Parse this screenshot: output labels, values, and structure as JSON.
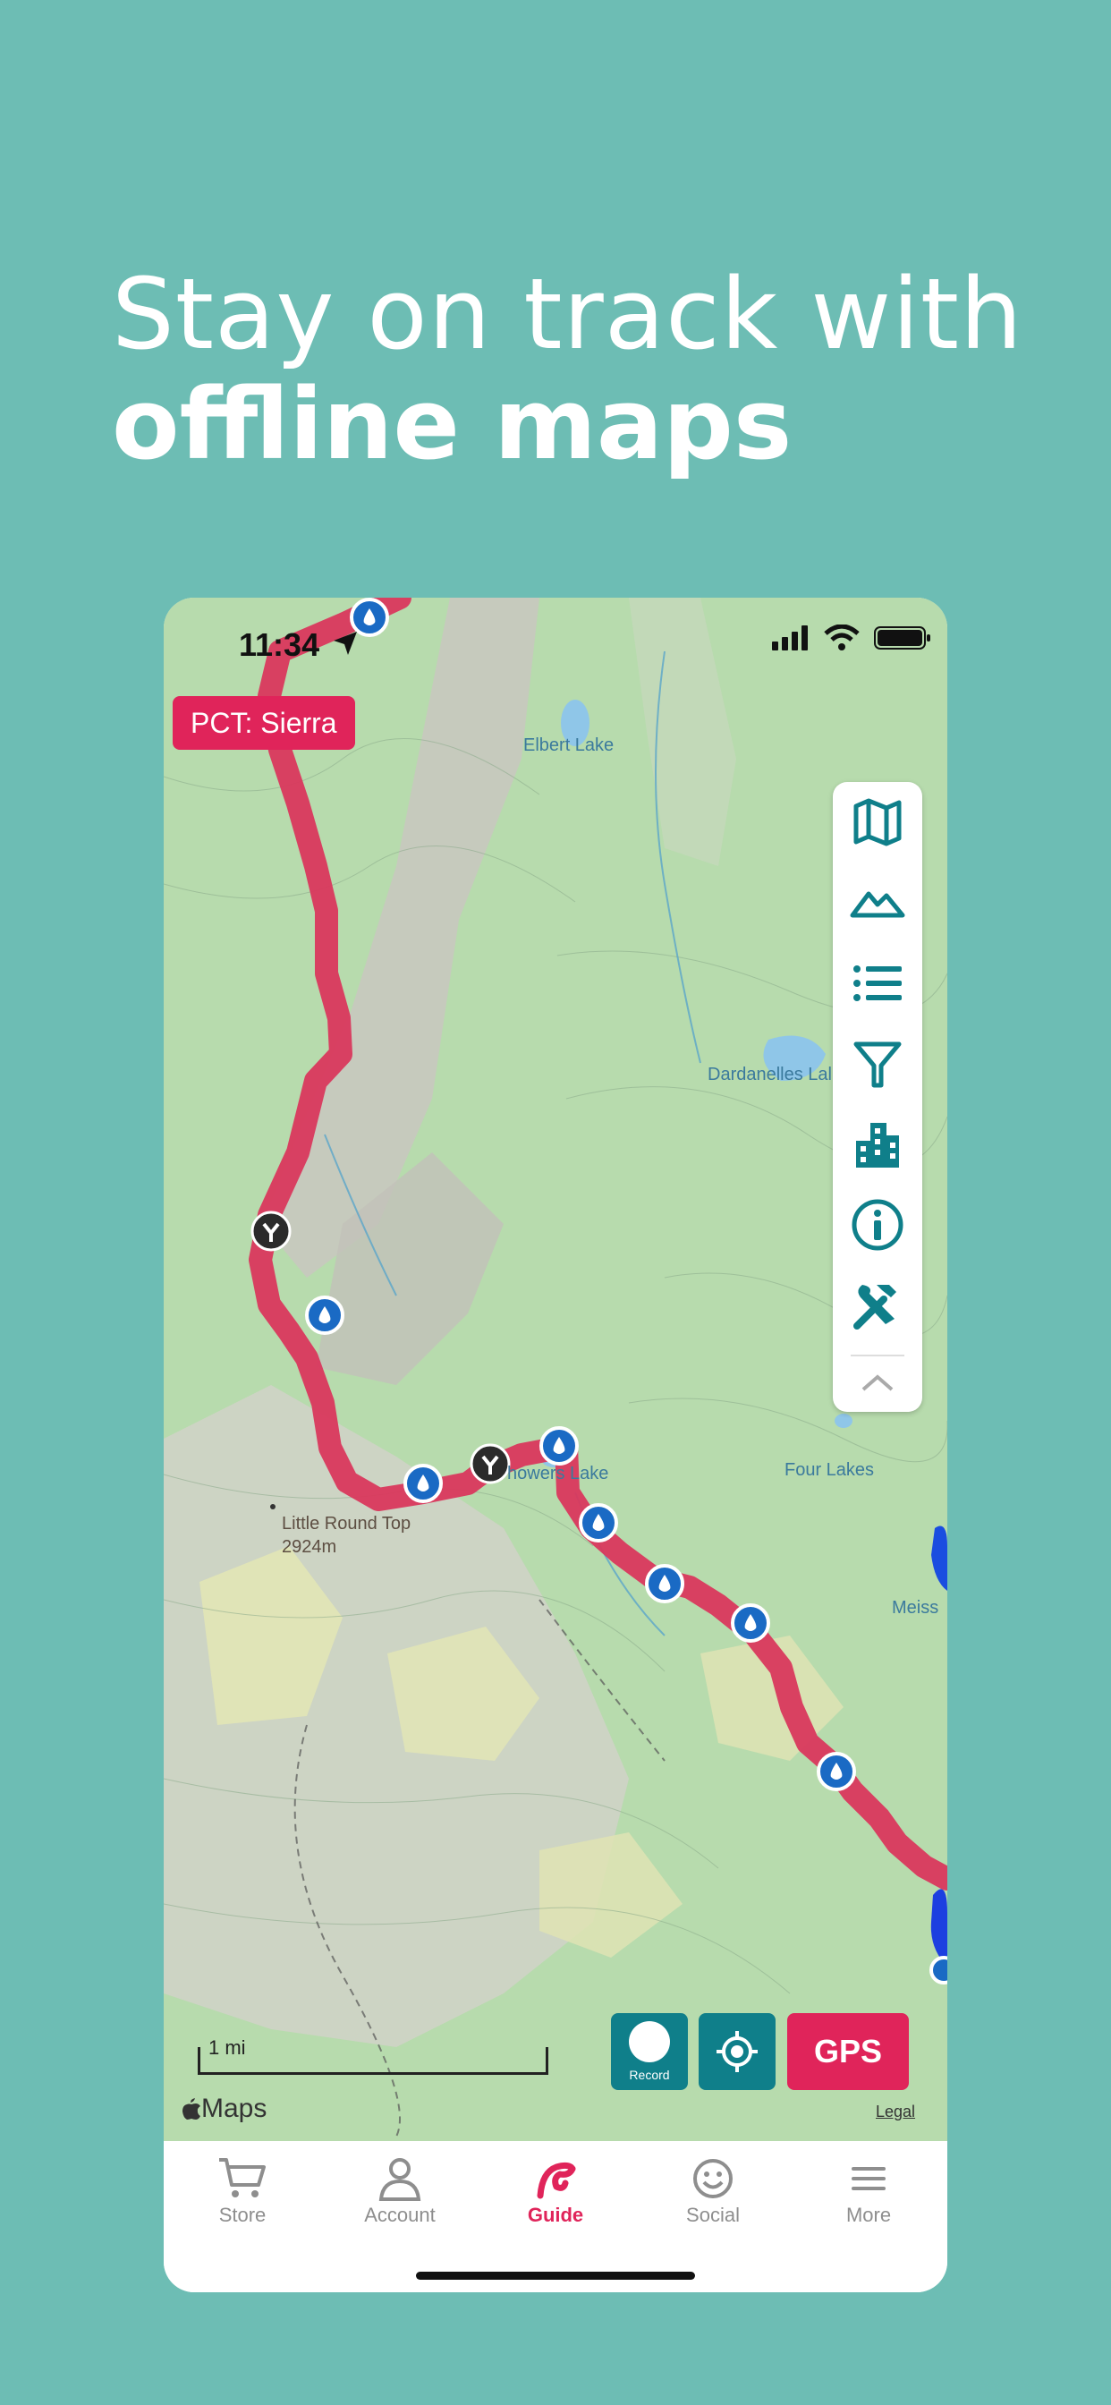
{
  "headline": {
    "line1": "Stay on track with",
    "line2": "offline maps"
  },
  "status": {
    "time": "11:34"
  },
  "route_badge": "PCT: Sierra",
  "map_labels": {
    "elbert_lake": "Elbert Lake",
    "dardanelles_lake": "Dardanelles Lal",
    "showers_lake": "howers Lake",
    "four_lakes": "Four Lakes",
    "meiss": "Meiss",
    "little_round_top": "Little Round Top",
    "little_round_top_elev": "2924m"
  },
  "toolbar_icons": [
    "map-icon",
    "mountain-icon",
    "list-icon",
    "filter-icon",
    "buildings-icon",
    "info-icon",
    "tools-icon",
    "chevron-up-icon"
  ],
  "controls": {
    "record_label": "Record",
    "gps_label": "GPS"
  },
  "scale_label": "1 mi",
  "attribution": {
    "maps": "Maps",
    "legal": "Legal"
  },
  "tabs": [
    {
      "label": "Store",
      "icon": "cart-icon"
    },
    {
      "label": "Account",
      "icon": "person-icon"
    },
    {
      "label": "Guide",
      "icon": "guide-icon",
      "active": true
    },
    {
      "label": "Social",
      "icon": "smiley-icon"
    },
    {
      "label": "More",
      "icon": "menu-icon"
    }
  ],
  "colors": {
    "background": "#6dbdb4",
    "accent": "#e0245a",
    "teal": "#0f7f8a",
    "water_marker": "#1a6ac4"
  }
}
